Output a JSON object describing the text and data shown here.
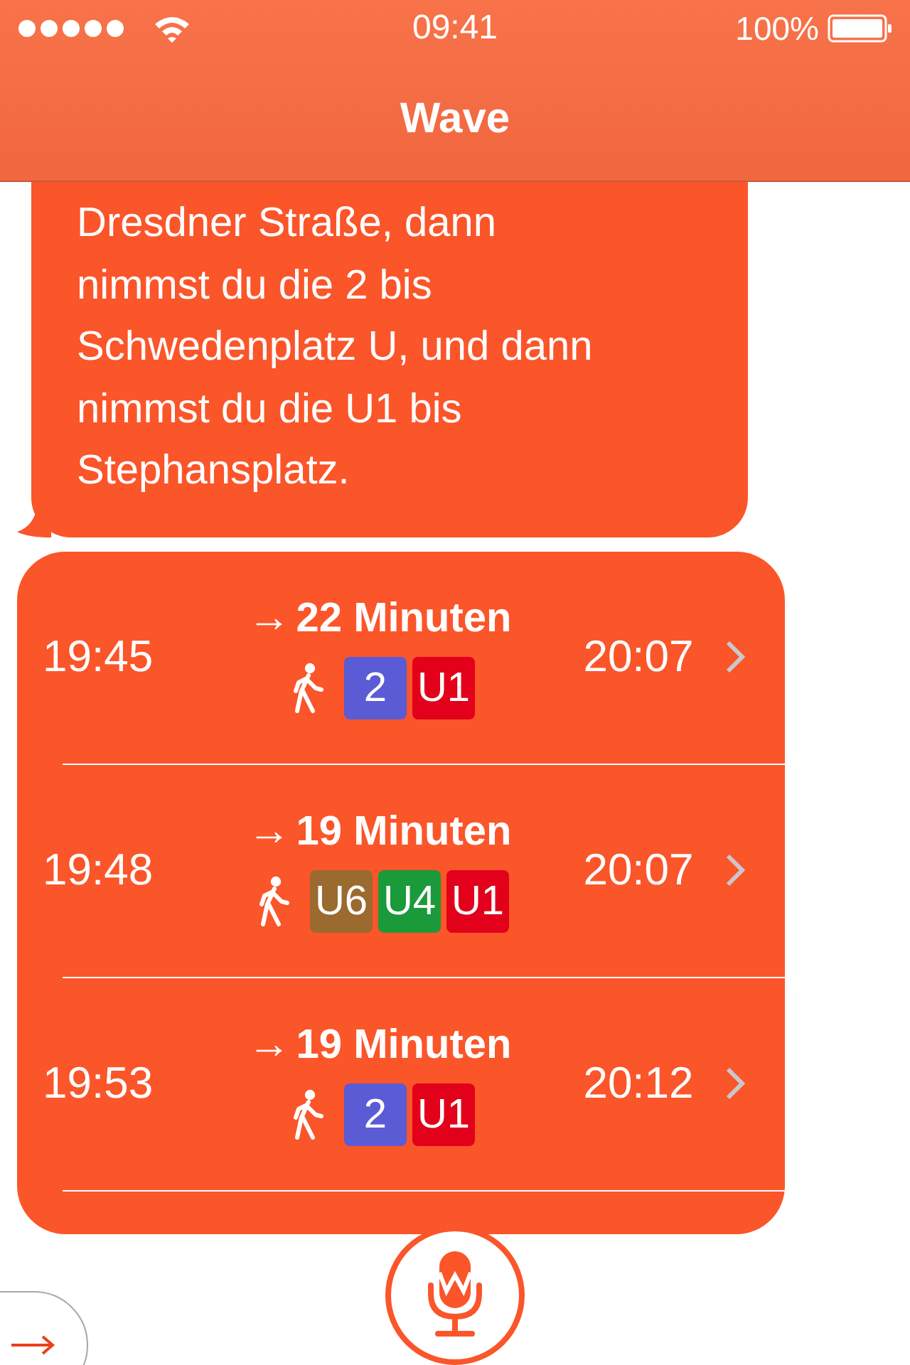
{
  "status_bar": {
    "time": "09:41",
    "battery": "100%"
  },
  "nav": {
    "title": "Wave"
  },
  "message": {
    "lines": [
      "Dresdner Straße, dann",
      "nimmst du die 2 bis",
      "Schwedenplatz U, und dann",
      "nimmst du die U1 bis",
      "Stephansplatz."
    ]
  },
  "routes": [
    {
      "depart": "19:45",
      "arrow": "→",
      "duration": "22 Minuten",
      "arrive": "20:07",
      "lines": [
        {
          "label": "2",
          "color": "#5b5bd6"
        },
        {
          "label": "U1",
          "color": "#e2001a"
        }
      ]
    },
    {
      "depart": "19:48",
      "arrow": "→",
      "duration": "19 Minuten",
      "arrive": "20:07",
      "lines": [
        {
          "label": "U6",
          "color": "#9a6a2f"
        },
        {
          "label": "U4",
          "color": "#1a9a3a"
        },
        {
          "label": "U1",
          "color": "#e2001a"
        }
      ]
    },
    {
      "depart": "19:53",
      "arrow": "→",
      "duration": "19 Minuten",
      "arrive": "20:12",
      "lines": [
        {
          "label": "2",
          "color": "#5b5bd6"
        },
        {
          "label": "U1",
          "color": "#e2001a"
        }
      ]
    }
  ]
}
